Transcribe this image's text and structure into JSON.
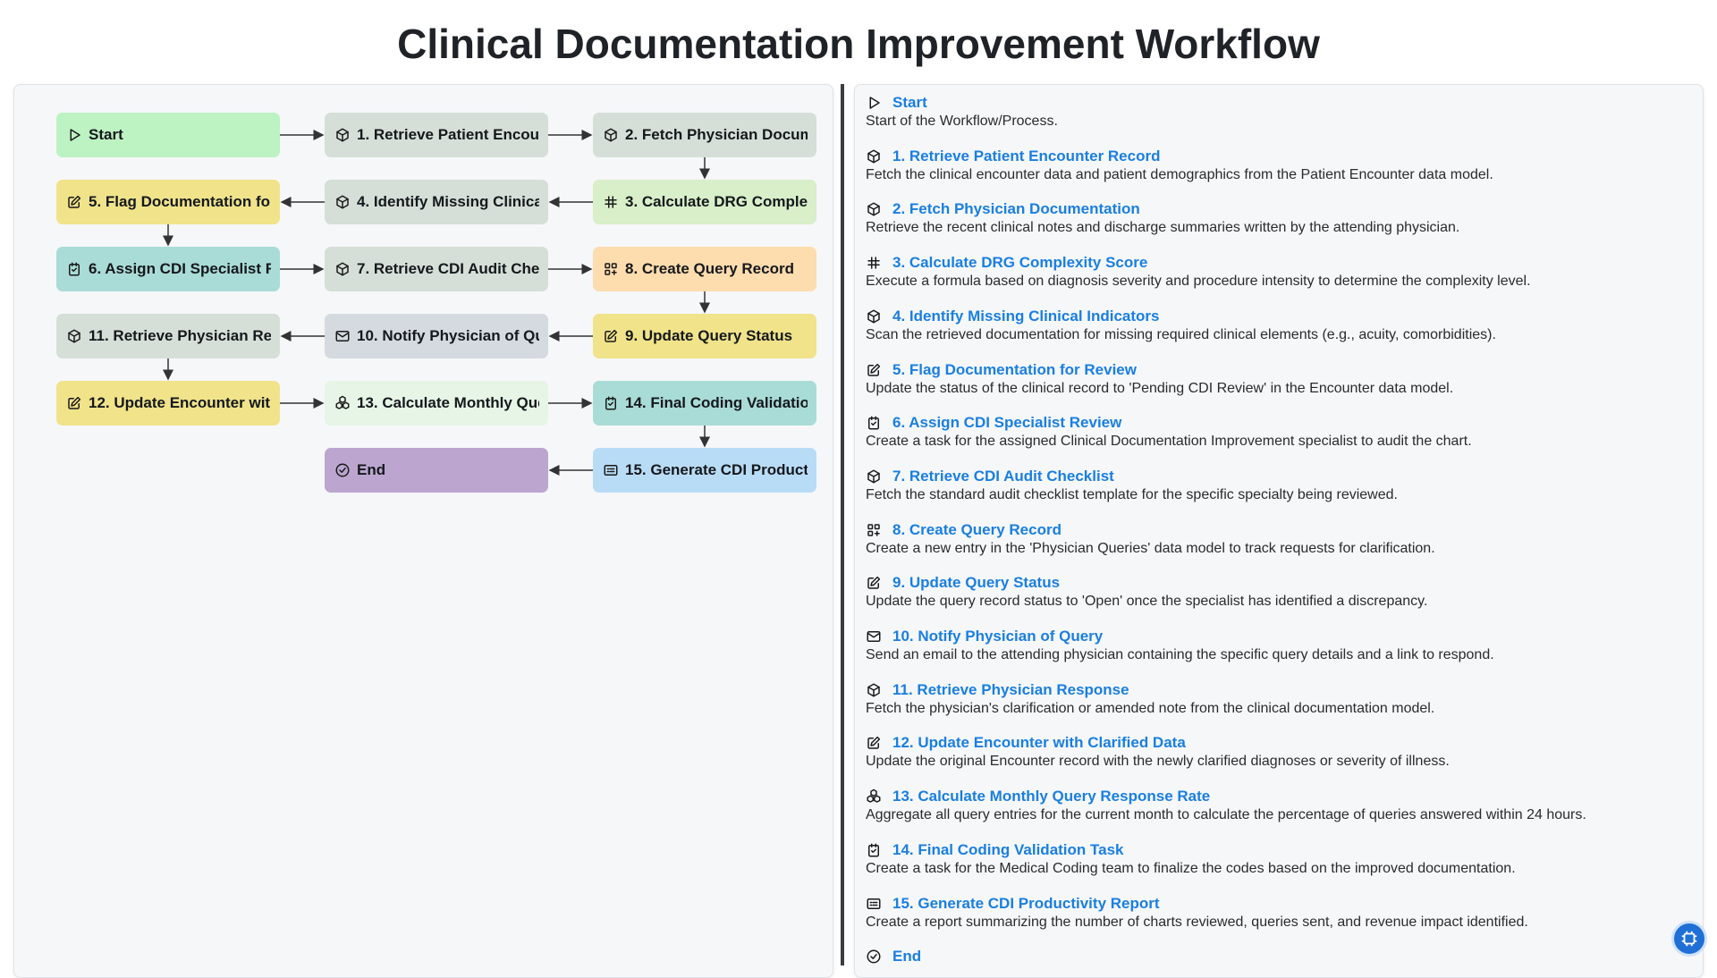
{
  "title": "Clinical Documentation Improvement Workflow",
  "colors": {
    "green": "#bdf2c2",
    "grey": "#d6dfd7",
    "mint": "#d8efc9",
    "yellow": "#f0e38a",
    "teal": "#a9dcd7",
    "peach": "#fddcae",
    "slate": "#d4dae0",
    "palegreen": "#e6f5e6",
    "purple": "#bca6d0",
    "blue": "#b9dcf6",
    "link": "#1a7fe0"
  },
  "nodes": [
    {
      "id": "start",
      "label": "Start",
      "icon": "play-icon",
      "color": "#bdf2c2"
    },
    {
      "id": "s1",
      "label": "1. Retrieve Patient Encounter Record",
      "icon": "cube-icon",
      "color": "#d6dfd7"
    },
    {
      "id": "s2",
      "label": "2. Fetch Physician Documentation",
      "icon": "cube-icon",
      "color": "#d6dfd7"
    },
    {
      "id": "s3",
      "label": "3. Calculate DRG Complexity Score",
      "icon": "hash-icon",
      "color": "#d8efc9"
    },
    {
      "id": "s4",
      "label": "4. Identify Missing Clinical Indicators",
      "icon": "cube-icon",
      "color": "#d6dfd7"
    },
    {
      "id": "s5",
      "label": "5. Flag Documentation for Review",
      "icon": "edit-icon",
      "color": "#f0e38a"
    },
    {
      "id": "s6",
      "label": "6. Assign CDI Specialist Review",
      "icon": "task-icon",
      "color": "#a9dcd7"
    },
    {
      "id": "s7",
      "label": "7. Retrieve CDI Audit Checklist",
      "icon": "cube-icon",
      "color": "#d6dfd7"
    },
    {
      "id": "s8",
      "label": "8. Create Query Record",
      "icon": "grid-plus-icon",
      "color": "#fddcae"
    },
    {
      "id": "s9",
      "label": "9. Update Query Status",
      "icon": "edit-icon",
      "color": "#f0e38a"
    },
    {
      "id": "s10",
      "label": "10. Notify Physician of Query",
      "icon": "mail-icon",
      "color": "#d4dae0"
    },
    {
      "id": "s11",
      "label": "11. Retrieve Physician Response",
      "icon": "cube-icon",
      "color": "#d6dfd7"
    },
    {
      "id": "s12",
      "label": "12. Update Encounter with Clarified Data",
      "icon": "edit-icon",
      "color": "#f0e38a"
    },
    {
      "id": "s13",
      "label": "13. Calculate Monthly Query Response Rate",
      "icon": "cubes-icon",
      "color": "#e6f5e6"
    },
    {
      "id": "s14",
      "label": "14. Final Coding Validation Task",
      "icon": "task-icon",
      "color": "#a9dcd7"
    },
    {
      "id": "s15",
      "label": "15. Generate CDI Productivity Report",
      "icon": "report-icon",
      "color": "#b9dcf6"
    },
    {
      "id": "end",
      "label": "End",
      "icon": "check-circle-icon",
      "color": "#bca6d0"
    }
  ],
  "steps": [
    {
      "name": "Start",
      "icon": "play-icon",
      "desc": "Start of the Workflow/Process."
    },
    {
      "name": "1. Retrieve Patient Encounter Record",
      "icon": "cube-icon",
      "desc": "Fetch the clinical encounter data and patient demographics from the Patient Encounter data model."
    },
    {
      "name": "2. Fetch Physician Documentation",
      "icon": "cube-icon",
      "desc": "Retrieve the recent clinical notes and discharge summaries written by the attending physician."
    },
    {
      "name": "3. Calculate DRG Complexity Score",
      "icon": "hash-icon",
      "desc": "Execute a formula based on diagnosis severity and procedure intensity to determine the complexity level."
    },
    {
      "name": "4. Identify Missing Clinical Indicators",
      "icon": "cube-icon",
      "desc": "Scan the retrieved documentation for missing required clinical elements (e.g., acuity, comorbidities)."
    },
    {
      "name": "5. Flag Documentation for Review",
      "icon": "edit-icon",
      "desc": "Update the status of the clinical record to 'Pending CDI Review' in the Encounter data model."
    },
    {
      "name": "6. Assign CDI Specialist Review",
      "icon": "task-icon",
      "desc": "Create a task for the assigned Clinical Documentation Improvement specialist to audit the chart."
    },
    {
      "name": "7. Retrieve CDI Audit Checklist",
      "icon": "cube-icon",
      "desc": "Fetch the standard audit checklist template for the specific specialty being reviewed."
    },
    {
      "name": "8. Create Query Record",
      "icon": "grid-plus-icon",
      "desc": "Create a new entry in the 'Physician Queries' data model to track requests for clarification."
    },
    {
      "name": "9. Update Query Status",
      "icon": "edit-icon",
      "desc": "Update the query record status to 'Open' once the specialist has identified a discrepancy."
    },
    {
      "name": "10. Notify Physician of Query",
      "icon": "mail-icon",
      "desc": "Send an email to the attending physician containing the specific query details and a link to respond."
    },
    {
      "name": "11. Retrieve Physician Response",
      "icon": "cube-icon",
      "desc": "Fetch the physician's clarification or amended note from the clinical documentation model."
    },
    {
      "name": "12. Update Encounter with Clarified Data",
      "icon": "edit-icon",
      "desc": "Update the original Encounter record with the newly clarified diagnoses or severity of illness."
    },
    {
      "name": "13. Calculate Monthly Query Response Rate",
      "icon": "cubes-icon",
      "desc": "Aggregate all query entries for the current month to calculate the percentage of queries answered within 24 hours."
    },
    {
      "name": "14. Final Coding Validation Task",
      "icon": "task-icon",
      "desc": "Create a task for the Medical Coding team to finalize the codes based on the improved documentation."
    },
    {
      "name": "15. Generate CDI Productivity Report",
      "icon": "report-icon",
      "desc": "Create a report summarizing the number of charts reviewed, queries sent, and revenue impact identified."
    },
    {
      "name": "End",
      "icon": "check-circle-icon",
      "desc": ""
    }
  ],
  "edges": [
    [
      "start",
      "s1"
    ],
    [
      "s1",
      "s2"
    ],
    [
      "s2",
      "s3"
    ],
    [
      "s3",
      "s4"
    ],
    [
      "s4",
      "s5"
    ],
    [
      "s5",
      "s6"
    ],
    [
      "s6",
      "s7"
    ],
    [
      "s7",
      "s8"
    ],
    [
      "s8",
      "s9"
    ],
    [
      "s9",
      "s10"
    ],
    [
      "s10",
      "s11"
    ],
    [
      "s11",
      "s12"
    ],
    [
      "s12",
      "s13"
    ],
    [
      "s13",
      "s14"
    ],
    [
      "s14",
      "s15"
    ],
    [
      "s15",
      "end"
    ]
  ],
  "ai_button": {
    "icon": "ai-chip-icon"
  }
}
